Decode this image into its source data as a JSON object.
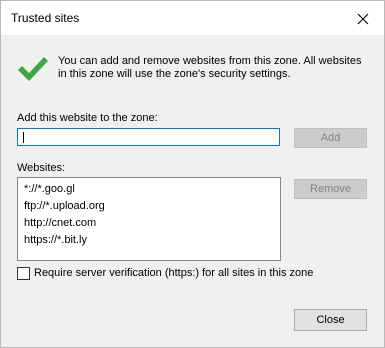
{
  "window": {
    "title": "Trusted sites"
  },
  "intro_text": "You can add and remove websites from this zone. All websites in this zone will use the zone's security settings.",
  "add_section": {
    "label": "Add this website to the zone:",
    "input_value": "",
    "add_button": "Add"
  },
  "websites_section": {
    "label": "Websites:",
    "items": [
      "*://*.goo.gl",
      "ftp://*.upload.org",
      "http://cnet.com",
      "https://*.bit.ly"
    ],
    "remove_button": "Remove"
  },
  "verification": {
    "label": "Require server verification (https:) for all sites in this zone",
    "checked": false
  },
  "close_button": "Close",
  "icons": {
    "title_close": "close-icon",
    "info": "green-check-icon"
  },
  "colors": {
    "accent": "#0078d7",
    "check_green": "#3ea845",
    "content_bg": "#f0f0f0"
  }
}
